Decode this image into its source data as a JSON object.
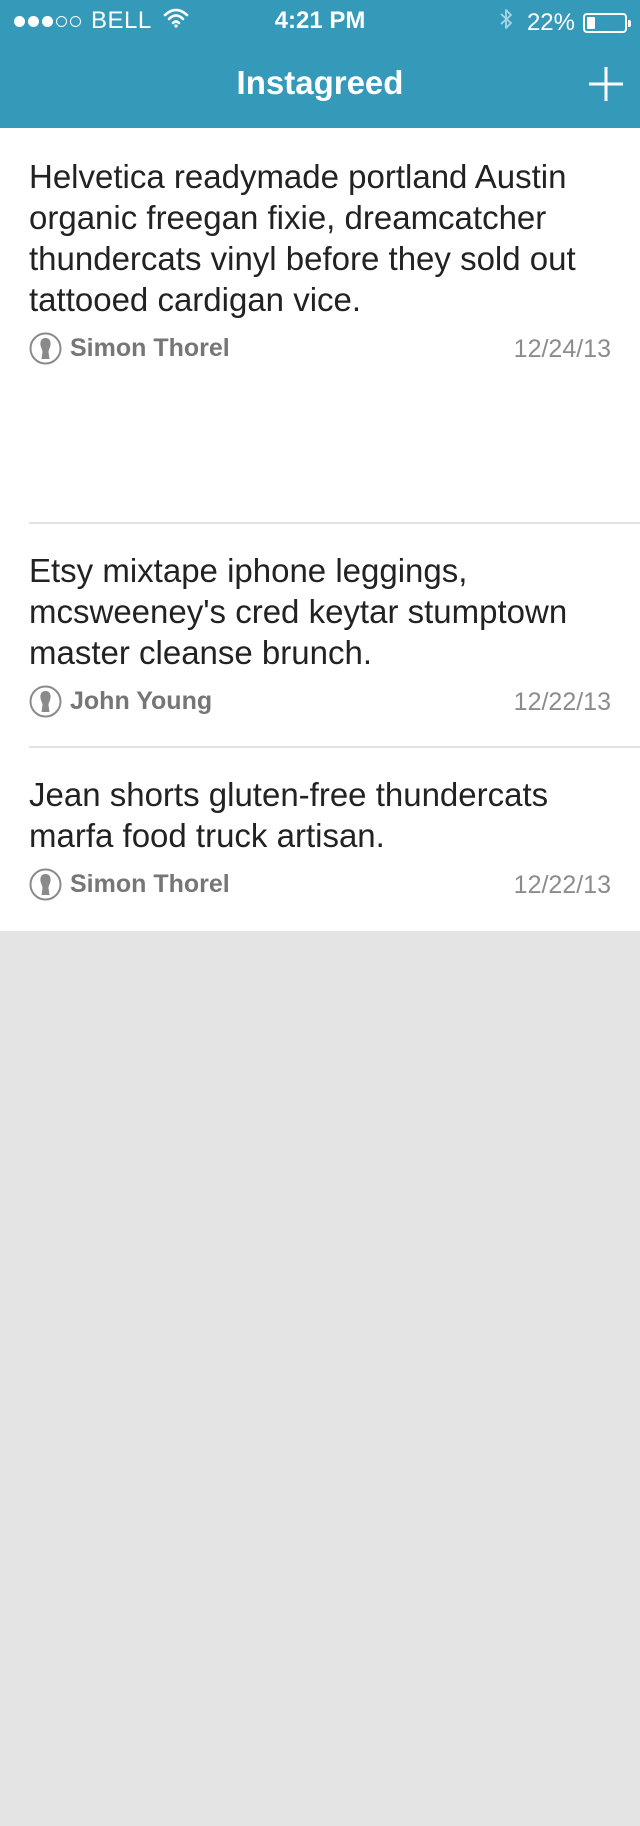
{
  "status_bar": {
    "signal_bars_filled": 3,
    "signal_bars_total": 5,
    "carrier": "BELL",
    "time": "4:21 PM",
    "battery_percent": "22%",
    "battery_level": 0.22,
    "icons": [
      "wifi-icon",
      "bluetooth-icon",
      "battery-icon"
    ]
  },
  "nav": {
    "title": "Instagreed",
    "add_icon": "plus-icon"
  },
  "colors": {
    "header": "#359ab9",
    "background": "#e4e4e4",
    "card": "#ffffff",
    "text": "#222222",
    "meta": "#767676"
  },
  "posts": [
    {
      "text": "Helvetica readymade portland Austin organic freegan fixie, dreamcatcher thundercats vinyl before they sold out tattooed cardigan vice.",
      "author": "Simon Thorel",
      "date": "12/24/13"
    },
    {
      "text": "Etsy mixtape iphone leggings, mcsweeney's cred keytar stumptown master cleanse brunch.",
      "author": "John Young",
      "date": "12/22/13"
    },
    {
      "text": "Jean shorts gluten-free thundercats marfa food truck artisan.",
      "author": "Simon Thorel",
      "date": "12/22/13"
    }
  ]
}
